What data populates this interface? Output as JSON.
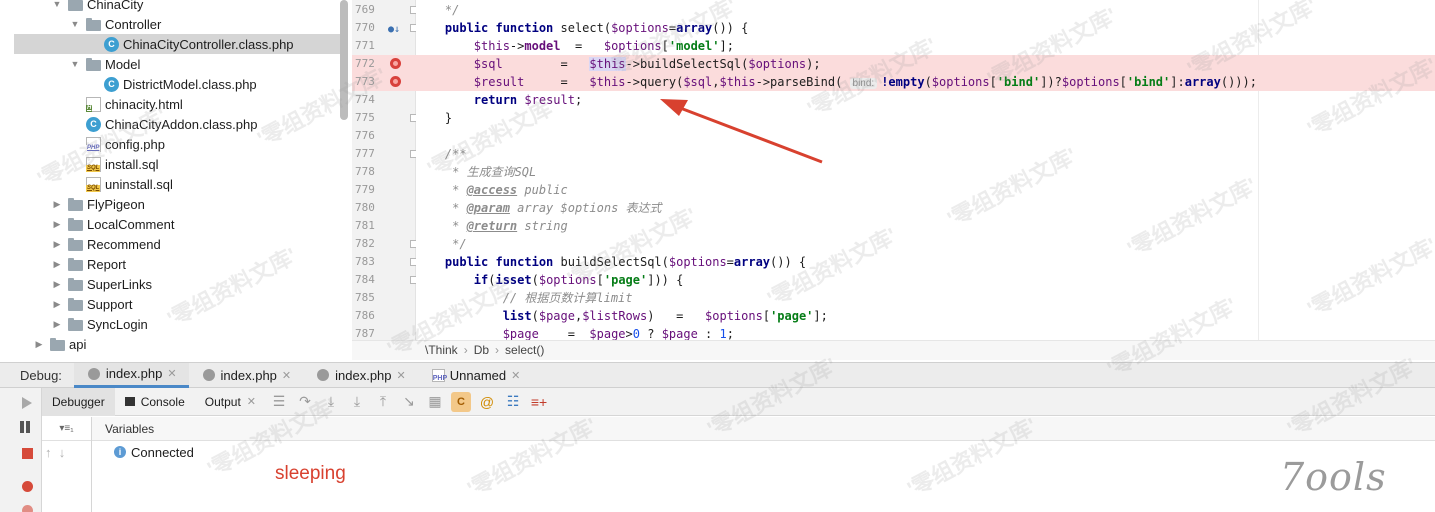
{
  "tree": {
    "items": [
      {
        "label": "ChinaCity",
        "kind": "folder",
        "depth": 1,
        "arrow": "▼",
        "icon": "folder-icon"
      },
      {
        "label": "Controller",
        "kind": "folder",
        "depth": 2,
        "arrow": "▼",
        "icon": "folder-icon"
      },
      {
        "label": "ChinaCityController.class.php",
        "kind": "class",
        "depth": 3,
        "arrow": "",
        "icon": "php-class-icon",
        "selected": true
      },
      {
        "label": "Model",
        "kind": "folder",
        "depth": 2,
        "arrow": "▼",
        "icon": "folder-icon"
      },
      {
        "label": "DistrictModel.class.php",
        "kind": "class",
        "depth": 3,
        "arrow": "",
        "icon": "php-class-icon"
      },
      {
        "label": "chinacity.html",
        "kind": "html",
        "depth": 2,
        "arrow": "",
        "icon": "html-file-icon"
      },
      {
        "label": "ChinaCityAddon.class.php",
        "kind": "class",
        "depth": 2,
        "arrow": "",
        "icon": "php-class-icon"
      },
      {
        "label": "config.php",
        "kind": "php",
        "depth": 2,
        "arrow": "",
        "icon": "php-file-icon"
      },
      {
        "label": "install.sql",
        "kind": "sql",
        "depth": 2,
        "arrow": "",
        "icon": "sql-file-icon"
      },
      {
        "label": "uninstall.sql",
        "kind": "sql",
        "depth": 2,
        "arrow": "",
        "icon": "sql-file-icon"
      },
      {
        "label": "FlyPigeon",
        "kind": "folder",
        "depth": 1,
        "arrow": "▶",
        "icon": "folder-icon"
      },
      {
        "label": "LocalComment",
        "kind": "folder",
        "depth": 1,
        "arrow": "▶",
        "icon": "folder-icon"
      },
      {
        "label": "Recommend",
        "kind": "folder",
        "depth": 1,
        "arrow": "▶",
        "icon": "folder-icon"
      },
      {
        "label": "Report",
        "kind": "folder",
        "depth": 1,
        "arrow": "▶",
        "icon": "folder-icon"
      },
      {
        "label": "SuperLinks",
        "kind": "folder",
        "depth": 1,
        "arrow": "▶",
        "icon": "folder-icon"
      },
      {
        "label": "Support",
        "kind": "folder",
        "depth": 1,
        "arrow": "▶",
        "icon": "folder-icon"
      },
      {
        "label": "SyncLogin",
        "kind": "folder",
        "depth": 1,
        "arrow": "▶",
        "icon": "folder-icon"
      },
      {
        "label": "api",
        "kind": "folder",
        "depth": 0,
        "arrow": "▶",
        "icon": "folder-icon"
      }
    ]
  },
  "editor": {
    "lines": [
      {
        "no": "769",
        "html": "    <span class=\"cm\">*/</span>"
      },
      {
        "no": "770",
        "html": "    <span class=\"kw\">public function</span> select(<span class=\"var\">$options</span>=<span class=\"kw\">array</span>()) {",
        "marker": "override"
      },
      {
        "no": "771",
        "html": "        <span class=\"var\">$this</span>-><span class=\"var\"><b>model</b></span>  =   <span class=\"var\">$options</span>[<span class=\"str\">'model'</span>];"
      },
      {
        "no": "772",
        "html": "        <span class=\"var\">$sql</span>        =   <span class=\"thishl\">$this</span>->buildSelectSql(<span class=\"var\">$options</span>);",
        "marker": "breakpoint"
      },
      {
        "no": "773",
        "html": "        <span class=\"var\">$result</span>     =   <span class=\"var\">$this</span>->query(<span class=\"var\">$sql</span>,<span class=\"var\">$this</span>->parseBind( <span class=\"hint\">bind:</span><span class=\"kw\">!empty</span>(<span class=\"var\">$options</span>[<span class=\"str\">'bind'</span>])?<span class=\"var\">$options</span>[<span class=\"str\">'bind'</span>]:<span class=\"kw\">array</span>()));",
        "marker": "breakpoint"
      },
      {
        "no": "774",
        "html": "        <span class=\"kw\">return</span> <span class=\"var\">$result</span>;"
      },
      {
        "no": "775",
        "html": "    }"
      },
      {
        "no": "776",
        "html": ""
      },
      {
        "no": "777",
        "html": "    <span class=\"cm\">/**</span>"
      },
      {
        "no": "778",
        "html": "     <span class=\"cm\">* 生成查询SQL</span>"
      },
      {
        "no": "779",
        "html": "     <span class=\"cm\">* </span><span class=\"tag\">@access</span><span class=\"cm\"> public</span>"
      },
      {
        "no": "780",
        "html": "     <span class=\"cm\">* </span><span class=\"tag\">@param</span><span class=\"cm\"> array $options 表达式</span>"
      },
      {
        "no": "781",
        "html": "     <span class=\"cm\">* </span><span class=\"tag\">@return</span><span class=\"cm\"> string</span>"
      },
      {
        "no": "782",
        "html": "     <span class=\"cm\">*/</span>"
      },
      {
        "no": "783",
        "html": "    <span class=\"kw\">public function</span> buildSelectSql(<span class=\"var\">$options</span>=<span class=\"kw\">array</span>()) {"
      },
      {
        "no": "784",
        "html": "        <span class=\"kw\">if</span>(<span class=\"kw\">isset</span>(<span class=\"var\">$options</span>[<span class=\"str\">'page'</span>])) {"
      },
      {
        "no": "785",
        "html": "            <span class=\"cm\">// 根据页数计算limit</span>"
      },
      {
        "no": "786",
        "html": "            <span class=\"kw\">list</span>(<span class=\"var\">$page</span>,<span class=\"var\">$listRows</span>)   =   <span class=\"var\">$options</span>[<span class=\"str\">'page'</span>];"
      },
      {
        "no": "787",
        "html": "            <span class=\"var\">$page</span>    =  <span class=\"var\">$page</span>><span class=\"num-lit\">0</span> ? <span class=\"var\">$page</span> : <span class=\"num-lit\">1</span>;"
      }
    ]
  },
  "breadcrumb": [
    "\\Think",
    "Db",
    "select()"
  ],
  "debug": {
    "label": "Debug:",
    "tabs": [
      {
        "label": "index.php",
        "active": true,
        "icon": "bug-icon"
      },
      {
        "label": "index.php",
        "active": false,
        "icon": "bug-icon"
      },
      {
        "label": "index.php",
        "active": false,
        "icon": "bug-icon"
      },
      {
        "label": "Unnamed",
        "active": false,
        "icon": "php-file-icon"
      }
    ],
    "subtabs": [
      "Debugger",
      "Console",
      "Output"
    ],
    "variables_header": "Variables",
    "status": "Connected",
    "frames_icon": "▾≡₁",
    "annotation": "sleeping"
  },
  "logo": "7ools",
  "watermark": "'零组资料文库'",
  "colors": {
    "accent": "#4a88c7",
    "breakpoint": "#d8413c",
    "annotation": "#d8412f"
  }
}
